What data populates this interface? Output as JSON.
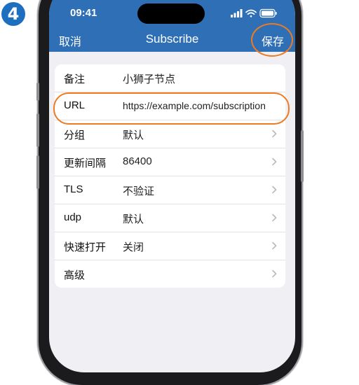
{
  "step": {
    "number": "4"
  },
  "status_bar": {
    "time": "09:41"
  },
  "nav": {
    "cancel": "取消",
    "title": "Subscribe",
    "save": "保存"
  },
  "rows": [
    {
      "label": "备注",
      "value": "小狮子节点",
      "chevron": false
    },
    {
      "label": "URL",
      "value": "https://example.com/subscription",
      "chevron": false
    },
    {
      "label": "分组",
      "value": "默认",
      "chevron": true
    },
    {
      "label": "更新间隔",
      "value": "86400",
      "chevron": true
    },
    {
      "label": "TLS",
      "value": "不验证",
      "chevron": true
    },
    {
      "label": "udp",
      "value": "默认",
      "chevron": true
    },
    {
      "label": "快速打开",
      "value": "关闭",
      "chevron": true
    },
    {
      "label": "高级",
      "value": "",
      "chevron": true
    }
  ],
  "colors": {
    "header": "#2f6fb6",
    "highlight": "#ee7a22",
    "badge": "#1f6fc1"
  }
}
